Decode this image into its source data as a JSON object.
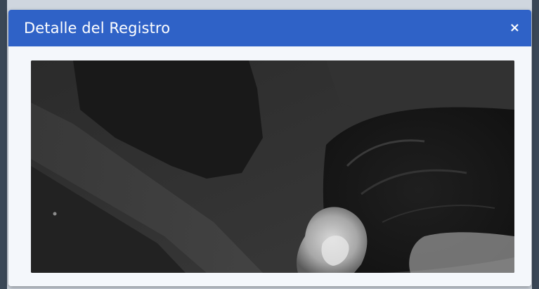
{
  "modal": {
    "title": "Detalle del Registro",
    "close_label": "×"
  },
  "colors": {
    "header": "#2f62c7",
    "body": "#f4f7fb",
    "title_text": "#ffffff"
  },
  "icons": {
    "close": "close-icon"
  }
}
